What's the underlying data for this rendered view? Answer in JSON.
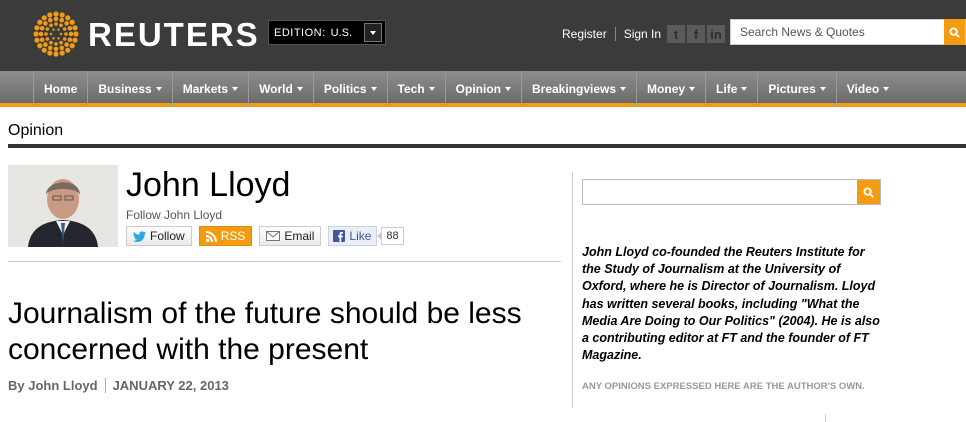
{
  "header": {
    "logo_text": "REUTERS",
    "edition_label": "EDITION:",
    "edition_value": "U.S.",
    "register": "Register",
    "sign_in": "Sign In",
    "social_icons": [
      "twitter-icon",
      "facebook-icon",
      "linkedin-icon"
    ],
    "search_placeholder": "Search News & Quotes"
  },
  "nav": {
    "items": [
      {
        "label": "Home",
        "dropdown": false
      },
      {
        "label": "Business",
        "dropdown": true
      },
      {
        "label": "Markets",
        "dropdown": true
      },
      {
        "label": "World",
        "dropdown": true
      },
      {
        "label": "Politics",
        "dropdown": true
      },
      {
        "label": "Tech",
        "dropdown": true
      },
      {
        "label": "Opinion",
        "dropdown": true
      },
      {
        "label": "Breakingviews",
        "dropdown": true
      },
      {
        "label": "Money",
        "dropdown": true
      },
      {
        "label": "Life",
        "dropdown": true
      },
      {
        "label": "Pictures",
        "dropdown": true
      },
      {
        "label": "Video",
        "dropdown": true
      }
    ]
  },
  "section": {
    "title": "Opinion"
  },
  "author": {
    "name": "John Lloyd",
    "follow_text": "Follow John Lloyd",
    "buttons": {
      "follow": "Follow",
      "rss": "RSS",
      "email": "Email",
      "like": "Like",
      "like_count": "88"
    }
  },
  "article": {
    "headline": "Journalism of the future should be less concerned with the present",
    "byline": "By John Lloyd",
    "date": "JANUARY 22, 2013"
  },
  "sidebar": {
    "bio": "John Lloyd co-founded the Reuters Institute for the Study of Journalism at the University of Oxford, where he is Director of Journalism. Lloyd has written several books, including \"What the Media Are Doing to Our Politics\" (2004). He is also a contributing editor at FT and the founder of FT Magazine.",
    "disclaimer": "Any opinions expressed here are the author's own."
  },
  "colors": {
    "accent": "#f39c12",
    "header_bg": "#3b3b3b",
    "nav_bg": "#7a7a7a"
  }
}
